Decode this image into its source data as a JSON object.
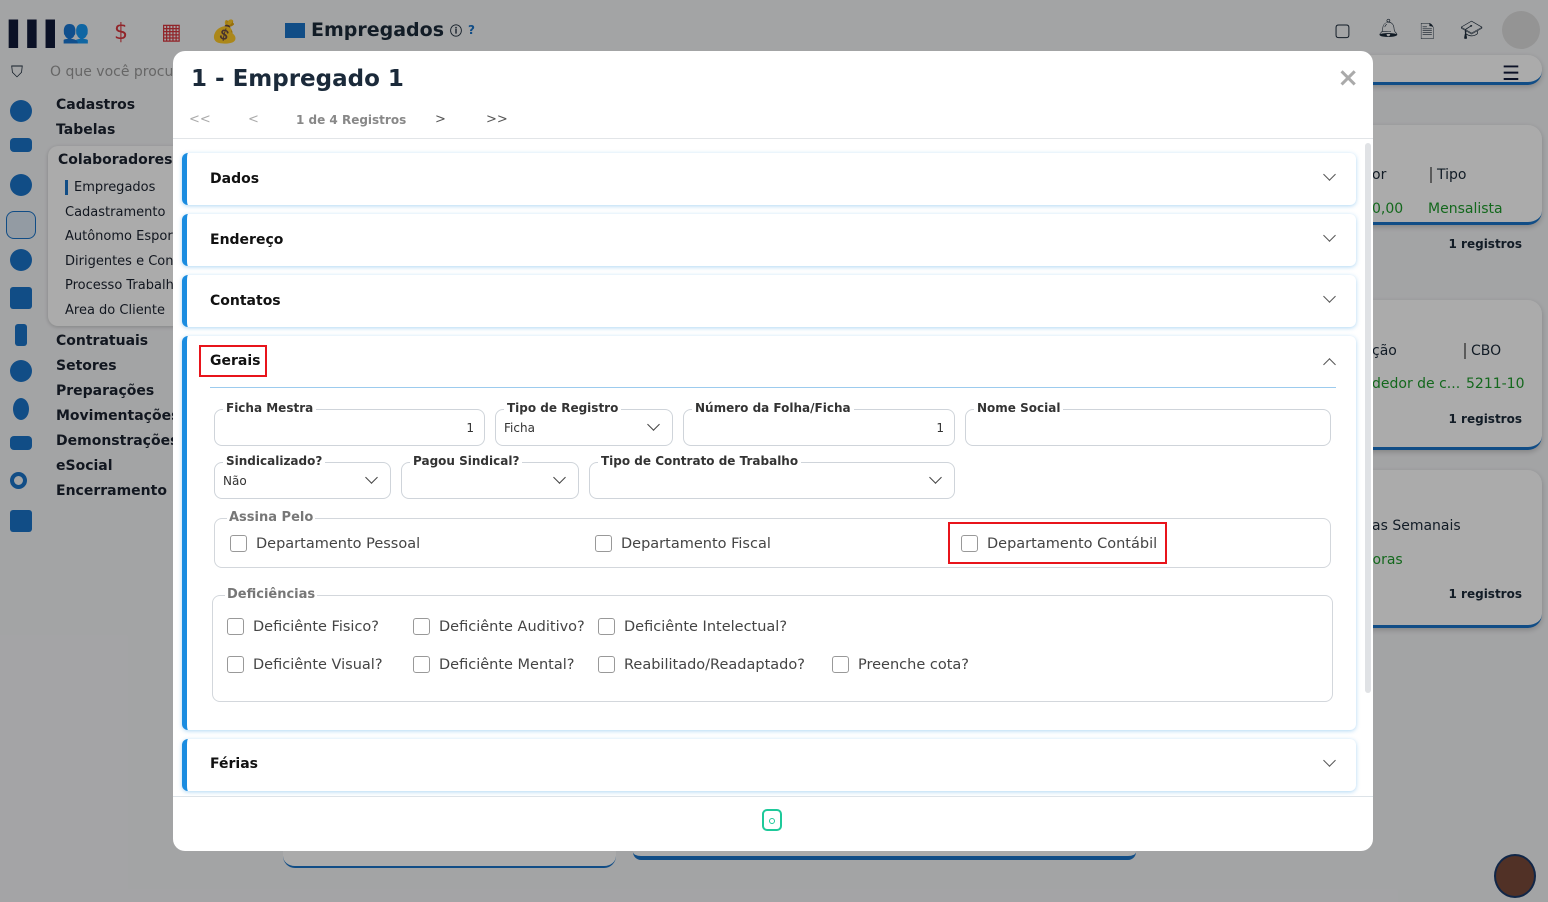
{
  "app": {
    "title": "Empregados",
    "search_placeholder": "O que você procura"
  },
  "sidebar": {
    "menus": [
      "Cadastros",
      "Tabelas"
    ],
    "group": "Colaboradores",
    "sub_items": [
      "Empregados",
      "Cadastramento",
      "Autônomo Esporádico",
      "Dirigentes e Contribuintes",
      "Processo Trabalhista",
      "Área do Cliente"
    ],
    "menus2": [
      "Contratuais",
      "Setores",
      "Preparações",
      "Movimentações",
      "Demonstrações",
      "eSocial",
      "Encerramento"
    ]
  },
  "right_cards": [
    {
      "header_partial": "or",
      "col": "Tipo",
      "val_partial": "0,00",
      "val": "Mensalista",
      "count": "1 registros"
    },
    {
      "header_partial": "ção",
      "col": "CBO",
      "val_partial": "dedor de c...",
      "val": "5211-10",
      "count": "1 registros"
    },
    {
      "header_partial": "as Semanais",
      "val_partial": "Horas",
      "count": "1 registros"
    }
  ],
  "modal": {
    "title": "1 - Empregado 1",
    "pager": {
      "first": "<<",
      "prev": "<",
      "status": "1 de 4 Registros",
      "next": ">",
      "last": ">>"
    },
    "close": "×",
    "sections": [
      "Dados",
      "Endereço",
      "Contatos",
      "Gerais",
      "Férias"
    ],
    "gerais": {
      "fields": {
        "ficha_mestra": {
          "label": "Ficha Mestra",
          "value": "1"
        },
        "tipo_registro": {
          "label": "Tipo de Registro",
          "value": "Ficha"
        },
        "numero_folha": {
          "label": "Número da Folha/Ficha",
          "value": "1"
        },
        "nome_social": {
          "label": "Nome Social",
          "value": ""
        },
        "sindicalizado": {
          "label": "Sindicalizado?",
          "value": "Não"
        },
        "pagou_sindical": {
          "label": "Pagou Sindical?",
          "value": ""
        },
        "tipo_contrato": {
          "label": "Tipo de Contrato de Trabalho",
          "value": ""
        }
      },
      "assina_pelo": {
        "label": "Assina Pelo",
        "options": [
          "Departamento Pessoal",
          "Departamento Fiscal",
          "Departamento Contábil"
        ]
      },
      "deficiencias": {
        "label": "Deficiências",
        "options": [
          "Deficiênte Fisico?",
          "Deficiênte Auditivo?",
          "Deficiênte Intelectual?",
          "Deficiênte Visual?",
          "Deficiênte Mental?",
          "Reabilitado/Readaptado?",
          "Preenche cota?"
        ]
      }
    }
  }
}
